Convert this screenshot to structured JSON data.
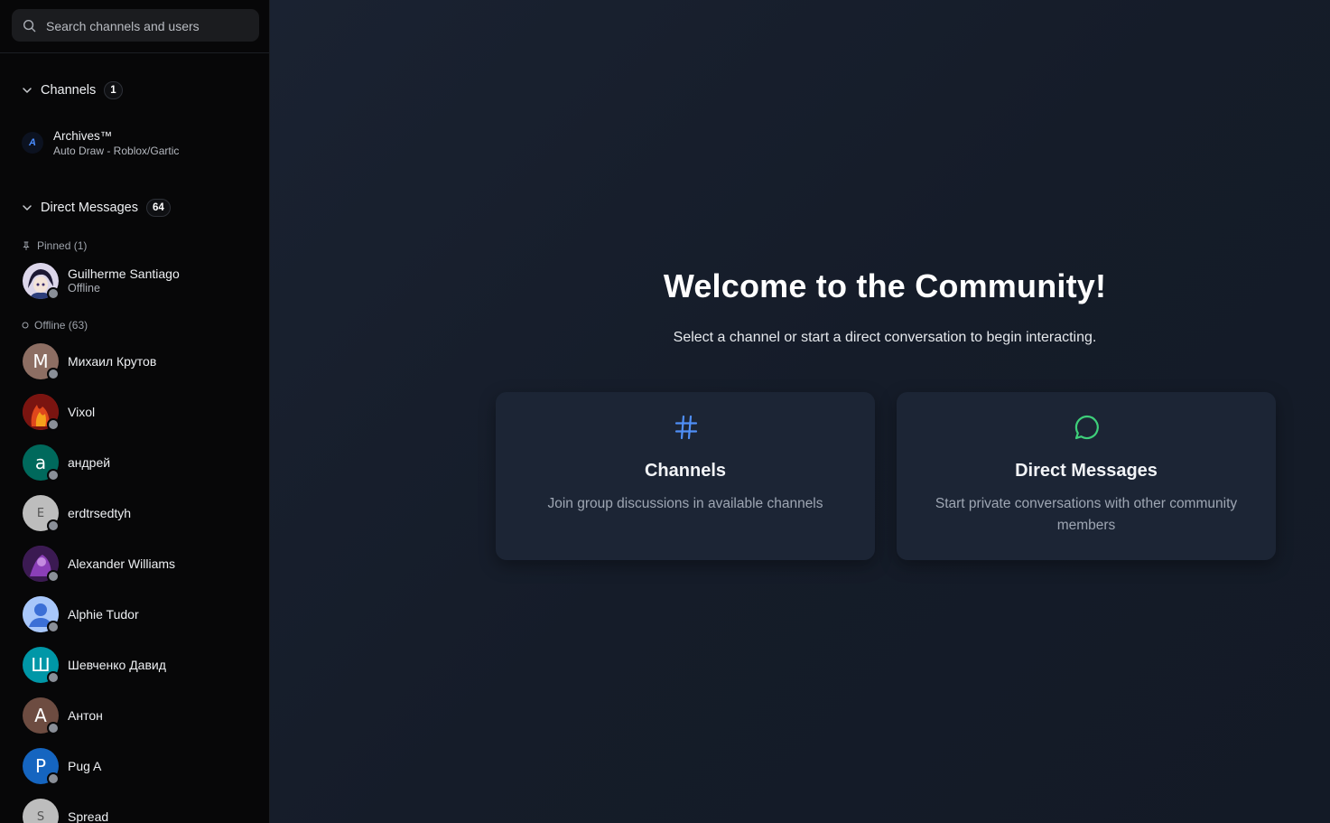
{
  "search": {
    "placeholder": "Search channels and users"
  },
  "channels": {
    "label": "Channels",
    "count": "1",
    "items": [
      {
        "name": "Archives™",
        "subtitle": "Auto Draw - Roblox/Gartic",
        "logo_text": "A"
      }
    ]
  },
  "direct_messages": {
    "label": "Direct Messages",
    "count": "64",
    "pinned_label": "Pinned (1)",
    "pinned": [
      {
        "name": "Guilherme Santiago",
        "status": "Offline"
      }
    ],
    "offline_label": "Offline (63)",
    "users": [
      {
        "name": "Михаил Крутов",
        "initial": "М",
        "color": "#8d6e63"
      },
      {
        "name": "Vixol",
        "initial": "",
        "color": "#b3261e"
      },
      {
        "name": "андрей",
        "initial": "а",
        "color": "#00695c"
      },
      {
        "name": "erdtrsedtyh",
        "initial": "E",
        "color": "#bdbdbd"
      },
      {
        "name": "Alexander Williams",
        "initial": "",
        "color": "#5e2a7a"
      },
      {
        "name": "Alphie Tudor",
        "initial": "",
        "color": "#a8c7fa"
      },
      {
        "name": "Шевченко Давид",
        "initial": "Ш",
        "color": "#0097a7"
      },
      {
        "name": "Антон",
        "initial": "А",
        "color": "#6d4c41"
      },
      {
        "name": "Pug A",
        "initial": "P",
        "color": "#1565c0"
      },
      {
        "name": "Spread",
        "initial": "S",
        "color": "#bdbdbd"
      }
    ]
  },
  "welcome": {
    "title": "Welcome to the Community!",
    "subtitle": "Select a channel or start a direct conversation to begin interacting."
  },
  "cards": [
    {
      "title": "Channels",
      "description": "Join group discussions in available channels",
      "icon": "hash-icon",
      "icon_color": "#4f8ff7"
    },
    {
      "title": "Direct Messages",
      "description": "Start private conversations with other community members",
      "icon": "chat-bubble-icon",
      "icon_color": "#3ecf7a"
    }
  ],
  "colors": {
    "status_offline": "#8a8f98",
    "accent_blue": "#4f8ff7",
    "accent_green": "#3ecf7a"
  }
}
